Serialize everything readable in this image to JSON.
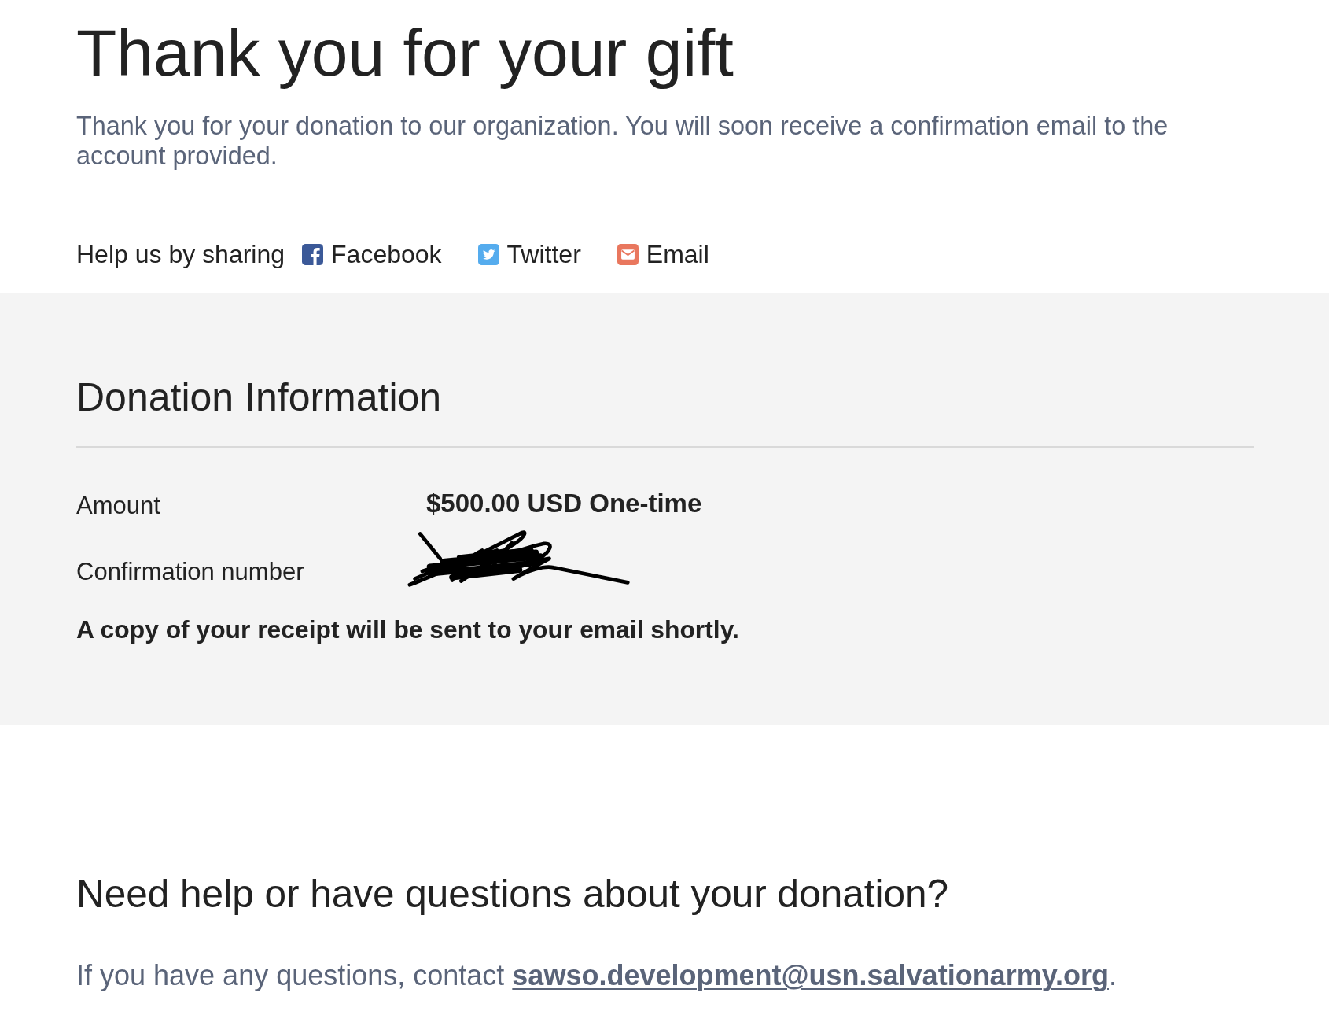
{
  "heading": {
    "title": "Thank you for your gift",
    "message": "Thank you for your donation to our organization. You will soon receive a confirmation email to the account provided."
  },
  "share": {
    "label": "Help us by sharing",
    "links": [
      {
        "kind": "facebook",
        "label": "Facebook"
      },
      {
        "kind": "twitter",
        "label": "Twitter"
      },
      {
        "kind": "email",
        "label": "Email"
      }
    ]
  },
  "donation_info": {
    "title": "Donation Information",
    "rows": [
      {
        "kind": "text",
        "label": "Amount",
        "value": "$500.00 USD One-time"
      },
      {
        "kind": "redacted",
        "label": "Confirmation number"
      }
    ],
    "note": "A copy of your receipt will be sent to your email shortly."
  },
  "help": {
    "title": "Need help or have questions about your donation?",
    "text": "If you have any questions, contact",
    "email": "sawso.development@usn.salvationarmy.org",
    "text_end": "."
  }
}
